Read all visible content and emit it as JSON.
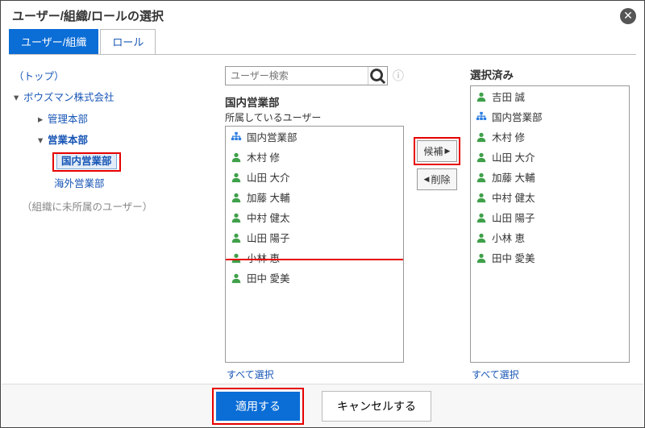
{
  "title": "ユーザー/組織/ロールの選択",
  "tabs": {
    "user_org": "ユーザー/組織",
    "role": "ロール"
  },
  "tree": {
    "top": "（トップ）",
    "company": "ボウズマン株式会社",
    "admin_dept": "管理本部",
    "sales_dept": "営業本部",
    "domestic": "国内営業部",
    "overseas": "海外営業部",
    "unassigned": "（組織に未所属のユーザー）"
  },
  "search": {
    "placeholder": "ユーザー検索"
  },
  "center": {
    "title": "国内営業部",
    "sub": "所属しているユーザー",
    "items": [
      {
        "type": "org",
        "label": "国内営業部"
      },
      {
        "type": "user",
        "label": "木村 修"
      },
      {
        "type": "user",
        "label": "山田 大介"
      },
      {
        "type": "user",
        "label": "加藤 大輔"
      },
      {
        "type": "user",
        "label": "中村 健太"
      },
      {
        "type": "user",
        "label": "山田 陽子"
      },
      {
        "type": "user",
        "label": "小林 恵"
      },
      {
        "type": "user",
        "label": "田中 愛美"
      }
    ],
    "select_all": "すべて選択"
  },
  "controls": {
    "add": "候補",
    "remove": "削除"
  },
  "right": {
    "title": "選択済み",
    "items": [
      {
        "type": "user",
        "label": "吉田 誠"
      },
      {
        "type": "org",
        "label": "国内営業部"
      },
      {
        "type": "user",
        "label": "木村 修"
      },
      {
        "type": "user",
        "label": "山田 大介"
      },
      {
        "type": "user",
        "label": "加藤 大輔"
      },
      {
        "type": "user",
        "label": "中村 健太"
      },
      {
        "type": "user",
        "label": "山田 陽子"
      },
      {
        "type": "user",
        "label": "小林 恵"
      },
      {
        "type": "user",
        "label": "田中 愛美"
      }
    ],
    "select_all": "すべて選択"
  },
  "footer": {
    "apply": "適用する",
    "cancel": "キャンセルする"
  }
}
